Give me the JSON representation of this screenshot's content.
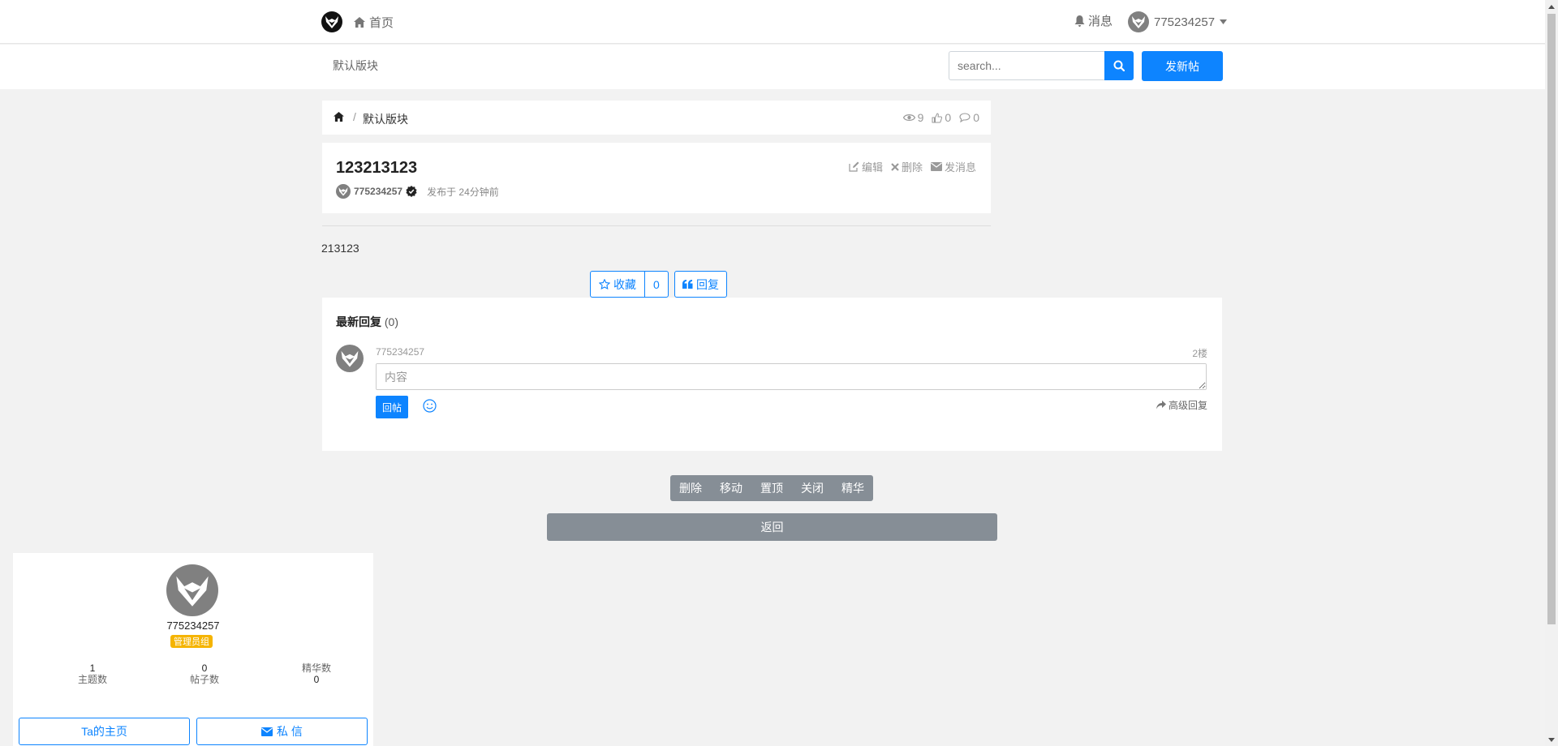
{
  "nav": {
    "home_label": "首页",
    "messages_label": "消息",
    "username": "775234257"
  },
  "subnav": {
    "board_label": "默认版块",
    "search_placeholder": "search...",
    "new_post_label": "发新帖"
  },
  "breadcrumb": {
    "board": "默认版块",
    "separator": "/",
    "views": "9",
    "likes": "0",
    "comments": "0"
  },
  "post": {
    "title": "123213123",
    "author": "775234257",
    "posted_text": "发布于 24分钟前",
    "content": "213123",
    "actions": {
      "edit": "编辑",
      "delete": "删除",
      "message": "发消息"
    }
  },
  "buttons": {
    "favorite_label": "收藏",
    "favorite_count": "0",
    "reply_label": "回复"
  },
  "replies": {
    "title": "最新回复",
    "count": "(0)",
    "user": "775234257",
    "floor": "2楼",
    "input_placeholder": "内容",
    "submit_label": "回帖",
    "advanced_label": "高级回复"
  },
  "admin": {
    "delete": "删除",
    "move": "移动",
    "top": "置顶",
    "close": "关闭",
    "digest": "精华",
    "back": "返回"
  },
  "profile": {
    "name": "775234257",
    "group": "管理员组",
    "stats": [
      {
        "label": "主题数",
        "value": "1"
      },
      {
        "label": "帖子数",
        "value": "0"
      },
      {
        "label": "精华数",
        "value": "0"
      }
    ],
    "home_button": "Ta的主页",
    "pm_button": "私 信"
  },
  "colors": {
    "primary": "#0d84ff",
    "secondary": "#868e96",
    "badge": "#f5b400",
    "background": "#f2f2f2"
  },
  "icons": [
    "logo-icon",
    "home-icon",
    "bell-icon",
    "caret-down-icon",
    "search-icon",
    "eye-icon",
    "thumbs-up-icon",
    "comment-icon",
    "edit-icon",
    "times-icon",
    "envelope-icon",
    "verified-icon",
    "star-icon",
    "quote-icon",
    "smile-icon",
    "share-icon"
  ]
}
